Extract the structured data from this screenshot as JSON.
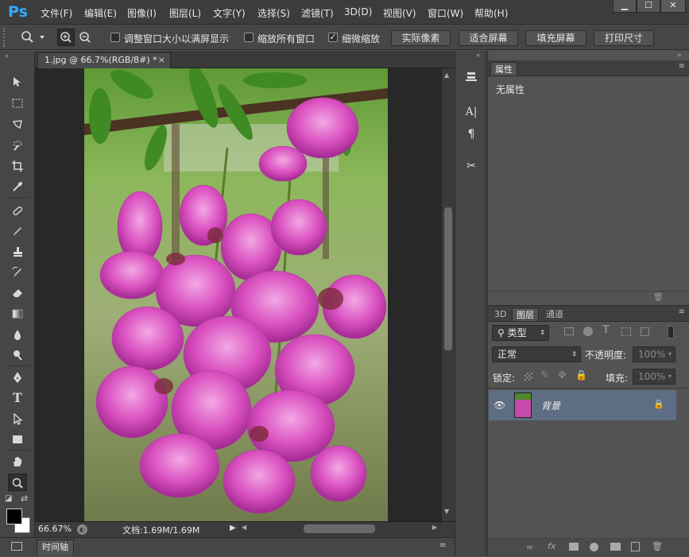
{
  "app": {
    "logo": "Ps"
  },
  "menu": [
    "文件(F)",
    "编辑(E)",
    "图像(I)",
    "图层(L)",
    "文字(Y)",
    "选择(S)",
    "滤镜(T)",
    "3D(D)",
    "视图(V)",
    "窗口(W)",
    "帮助(H)"
  ],
  "window_controls": {
    "minimize": "▁",
    "maximize": "☐",
    "close": "✕"
  },
  "options": {
    "resize_windows_label": "调整窗口大小以满屏显示",
    "zoom_all_label": "缩放所有窗口",
    "scrubby_zoom_label": "细微缩放",
    "scrubby_zoom_checked": true,
    "actual_pixels": "实际像素",
    "fit_screen": "适合屏幕",
    "fill_screen": "填充屏幕",
    "print_size": "打印尺寸"
  },
  "document": {
    "tab_title": "1.jpg @ 66.7%(RGB/8#) *",
    "close": "×",
    "zoom": "66.67%",
    "doc_size": "文档:1.69M/1.69M"
  },
  "timeline": {
    "label": "时间轴"
  },
  "properties": {
    "title": "属性",
    "content": "无属性"
  },
  "layers": {
    "tabs": [
      "3D",
      "图层",
      "通道"
    ],
    "filter_kind": "类型",
    "blend_mode": "正常",
    "opacity_label": "不透明度:",
    "opacity_value": "100%",
    "lock_label": "锁定:",
    "fill_label": "填充:",
    "fill_value": "100%",
    "layer_name": "背景"
  },
  "colors": {
    "accent": "#31a8ff",
    "selected_layer": "#5d6d83",
    "foreground": "#000000",
    "background": "#ffffff"
  }
}
